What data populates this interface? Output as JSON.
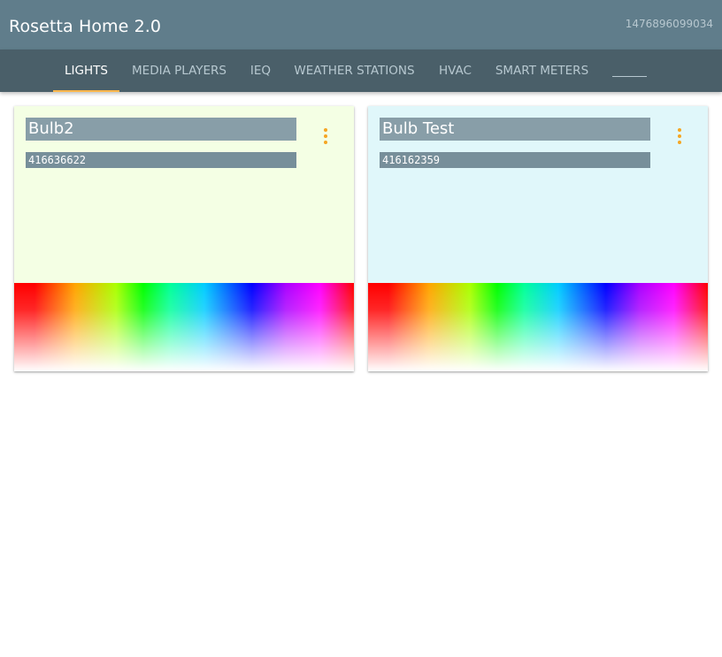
{
  "app": {
    "title": "Rosetta Home 2.0",
    "timestamp": "1476896099034"
  },
  "tabs": [
    {
      "label": "LIGHTS",
      "active": true
    },
    {
      "label": "MEDIA PLAYERS",
      "active": false
    },
    {
      "label": "IEQ",
      "active": false
    },
    {
      "label": "WEATHER STATIONS",
      "active": false
    },
    {
      "label": "HVAC",
      "active": false
    },
    {
      "label": "SMART METERS",
      "active": false
    }
  ],
  "cards": [
    {
      "name": "Bulb2",
      "id": "416636622",
      "background": "#f4ffe4"
    },
    {
      "name": "Bulb Test",
      "id": "416162359",
      "background": "#e0f7fa"
    }
  ],
  "colors": {
    "header": "#607d8b",
    "tab_bar": "#4a5f69",
    "accent": "#ffb74d",
    "menu_icon": "#f5a623"
  }
}
